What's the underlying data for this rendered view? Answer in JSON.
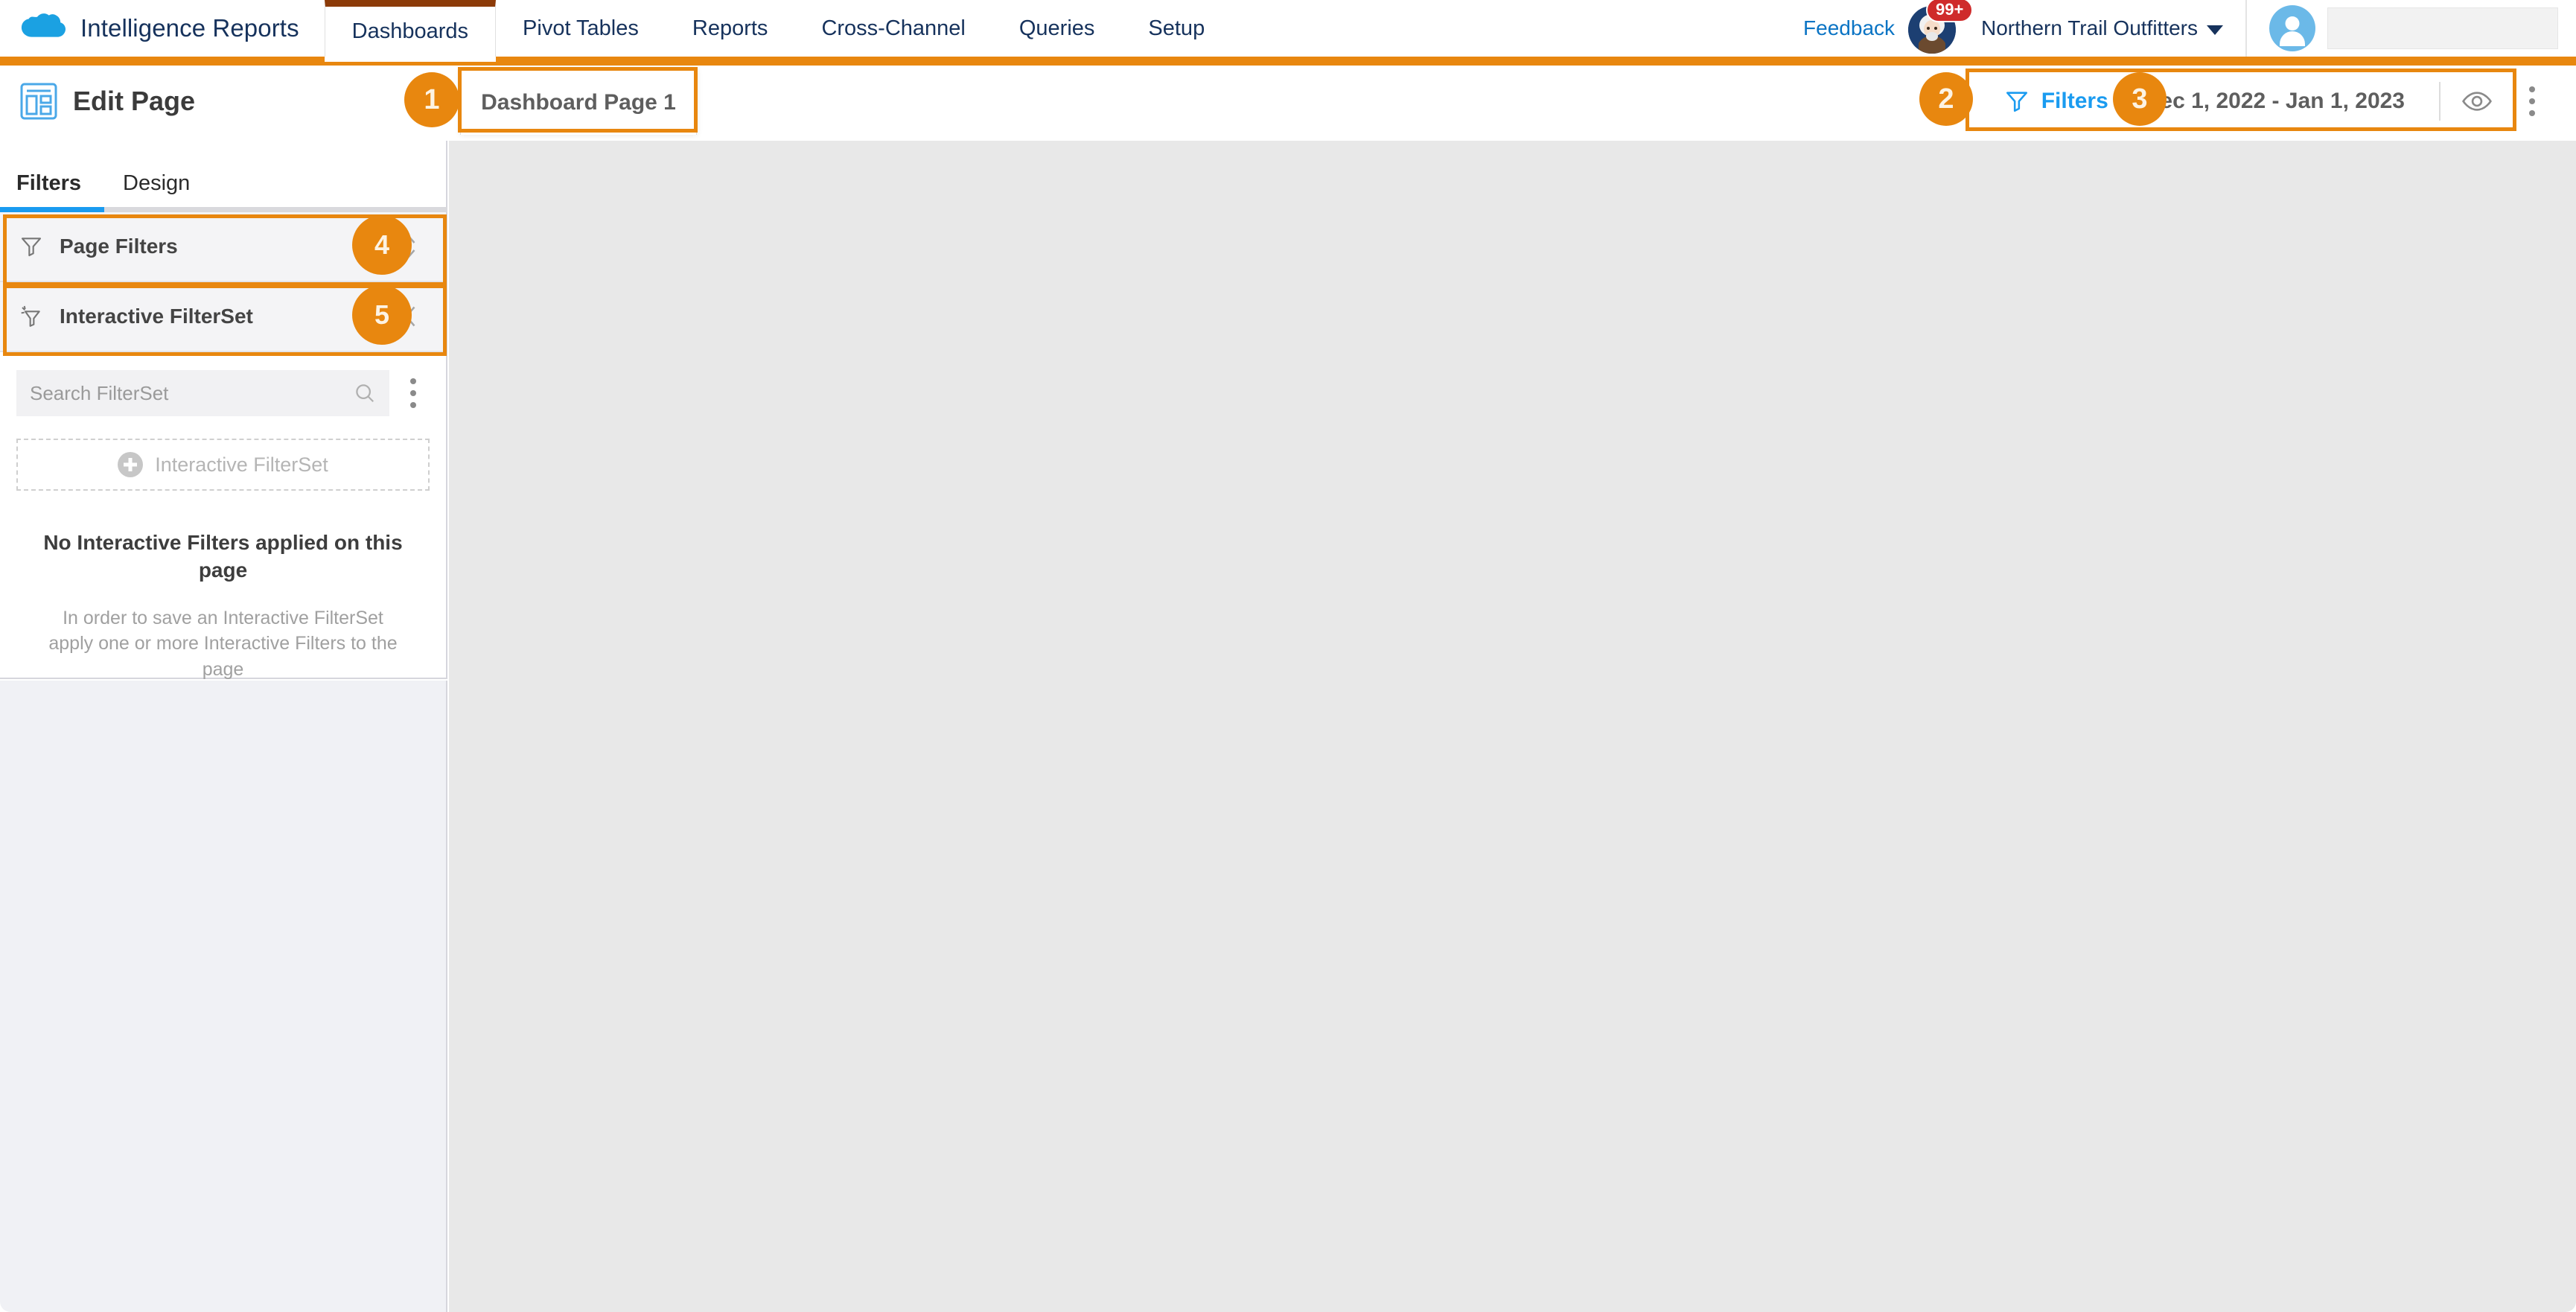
{
  "app": {
    "brand": "Intelligence Reports",
    "logo_icon": "salesforce-cloud-icon"
  },
  "topnav": {
    "tabs": [
      {
        "label": "Dashboards",
        "active": true
      },
      {
        "label": "Pivot Tables",
        "active": false
      },
      {
        "label": "Reports",
        "active": false
      },
      {
        "label": "Cross-Channel",
        "active": false
      },
      {
        "label": "Queries",
        "active": false
      },
      {
        "label": "Setup",
        "active": false
      }
    ],
    "feedback_label": "Feedback",
    "einstein_badge": "99+",
    "einstein_icon": "einstein-assistant-icon",
    "org_name": "Northern Trail Outfitters",
    "org_caret_icon": "chevron-down-icon",
    "user_avatar_icon": "user-avatar-icon"
  },
  "editbar": {
    "title": "Edit Page",
    "title_icon": "page-layout-icon",
    "page_tab_label": "Dashboard Page 1",
    "filters_label": "Filters",
    "filters_icon": "funnel-icon",
    "date_range": "Dec 1, 2022 - Jan 1, 2023",
    "preview_icon": "eye-icon",
    "more_icon": "kebab-menu-icon"
  },
  "panel": {
    "tabs": [
      {
        "label": "Filters",
        "active": true
      },
      {
        "label": "Design",
        "active": false
      }
    ],
    "rows": [
      {
        "label": "Page Filters",
        "icon": "funnel-icon",
        "control_icon": "expand-chevrons-icon"
      },
      {
        "label": "Interactive FilterSet",
        "icon": "sparkle-funnel-icon",
        "control_icon": "collapse-chevrons-icon"
      }
    ],
    "search": {
      "placeholder": "Search FilterSet",
      "icon": "search-icon",
      "more_icon": "kebab-menu-icon"
    },
    "add_button": {
      "label": "Interactive FilterSet",
      "icon": "plus-circle-icon"
    },
    "empty_state": {
      "title": "No Interactive Filters applied on this page",
      "subtitle": "In order to save an Interactive FilterSet apply one or more Interactive Filters to the page"
    }
  },
  "callouts": [
    {
      "number": "1",
      "target": "page-tab"
    },
    {
      "number": "2",
      "target": "filters-button"
    },
    {
      "number": "3",
      "target": "date-range"
    },
    {
      "number": "4",
      "target": "page-filters-row"
    },
    {
      "number": "5",
      "target": "interactive-filterset-row"
    }
  ],
  "colors": {
    "accent_orange": "#e8870f",
    "brand_navy": "#16325c",
    "link_blue": "#1a9bf0",
    "active_tab_border": "#8c3b08",
    "badge_red": "#cf2b2b",
    "canvas_gray": "#e8e8e8"
  }
}
